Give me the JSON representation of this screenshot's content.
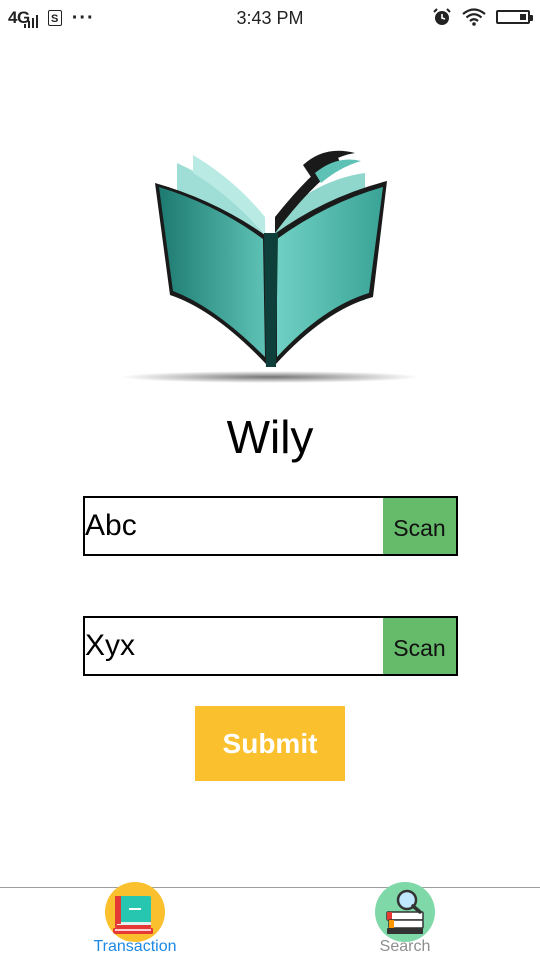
{
  "status_bar": {
    "network": "4G",
    "sim_label": "S",
    "more": "···",
    "time": "3:43 PM"
  },
  "app": {
    "title": "Wily"
  },
  "form": {
    "book_id_value": "Abc",
    "student_id_value": "Xyx",
    "scan_label_1": "Scan",
    "scan_label_2": "Scan",
    "submit_label": "Submit"
  },
  "tabs": [
    {
      "label": "Transaction",
      "active": true,
      "icon": "books-icon"
    },
    {
      "label": "Search",
      "active": false,
      "icon": "search-books-icon"
    }
  ],
  "colors": {
    "scan_button": "#66bb6a",
    "submit_button": "#fbc02d",
    "active_tab": "#1e88e5",
    "inactive_tab": "#8e8e8e",
    "logo_teal": "#4db6ac"
  }
}
